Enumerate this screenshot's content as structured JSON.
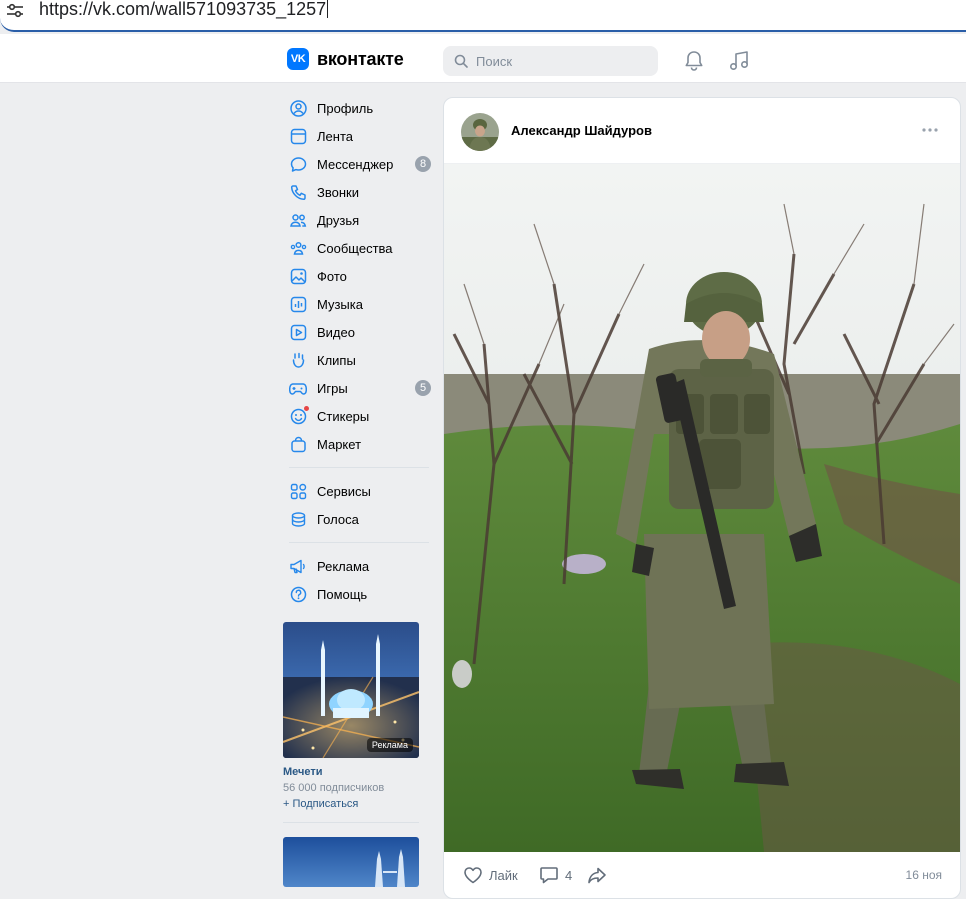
{
  "browser": {
    "url": "https://vk.com/wall571093735_1257"
  },
  "header": {
    "logo_mark": "VK",
    "logo_text": "вконтакте",
    "search_placeholder": "Поиск",
    "icons": [
      "bell-icon",
      "music-icon"
    ]
  },
  "nav": {
    "items": [
      {
        "label": "Профиль",
        "icon": "user-circle-icon"
      },
      {
        "label": "Лента",
        "icon": "feed-icon"
      },
      {
        "label": "Мессенджер",
        "icon": "chat-bubble-icon",
        "badge": "8"
      },
      {
        "label": "Звонки",
        "icon": "phone-icon"
      },
      {
        "label": "Друзья",
        "icon": "friends-icon"
      },
      {
        "label": "Сообщества",
        "icon": "communities-icon"
      },
      {
        "label": "Фото",
        "icon": "photo-icon"
      },
      {
        "label": "Музыка",
        "icon": "music-icon"
      },
      {
        "label": "Видео",
        "icon": "video-icon"
      },
      {
        "label": "Клипы",
        "icon": "clips-icon"
      },
      {
        "label": "Игры",
        "icon": "gamepad-icon",
        "badge": "5"
      },
      {
        "label": "Стикеры",
        "icon": "smile-icon"
      },
      {
        "label": "Маркет",
        "icon": "bag-icon"
      }
    ],
    "items2": [
      {
        "label": "Сервисы",
        "icon": "services-grid-icon"
      },
      {
        "label": "Голоса",
        "icon": "coins-icon"
      }
    ],
    "items3": [
      {
        "label": "Реклама",
        "icon": "megaphone-icon"
      },
      {
        "label": "Помощь",
        "icon": "help-icon"
      }
    ]
  },
  "ads": [
    {
      "tag": "Реклама",
      "title": "Мечети",
      "subscribers": "56 000 подписчиков",
      "subscribe": "+ Подписаться"
    }
  ],
  "post": {
    "author": "Александр Шайдуров",
    "actions": {
      "like": "Лайк",
      "comments": "4"
    },
    "date": "16 ноя"
  },
  "colors": {
    "accent": "#0077ff",
    "link": "#2a5885",
    "bg": "#edeef0"
  }
}
